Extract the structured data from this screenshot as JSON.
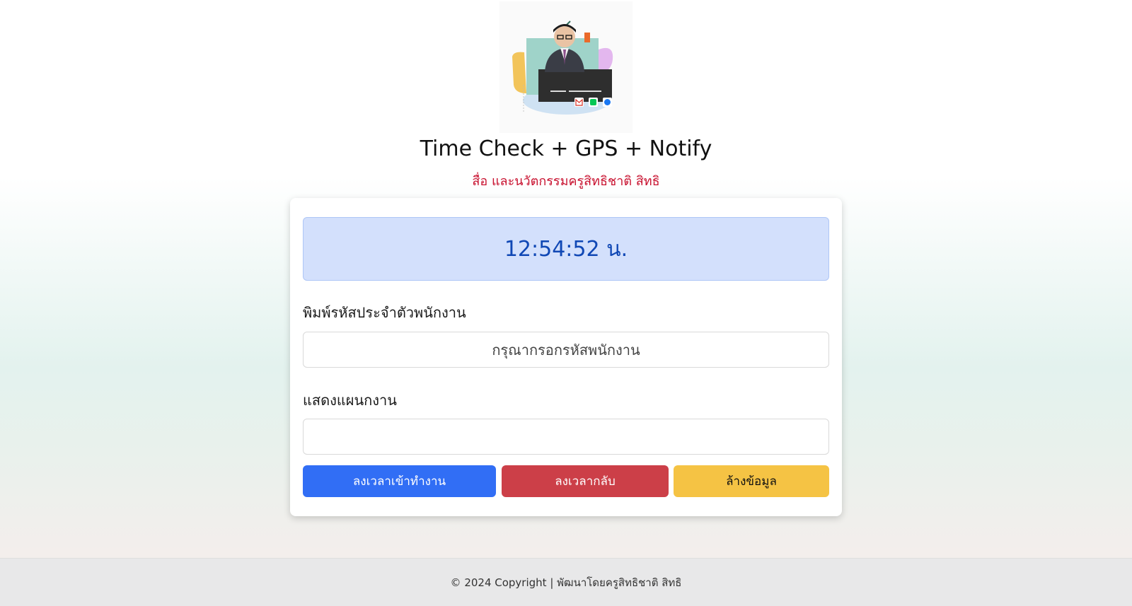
{
  "header": {
    "title": "Time Check + GPS + Notify",
    "subtitle": "สื่อ และนวัตกรรมครูสิทธิชาติ สิทธิ"
  },
  "clock": {
    "time": "12:54:52 น."
  },
  "form": {
    "employee_id_label": "พิมพ์รหัสประจำตัวพนักงาน",
    "employee_id_placeholder": "กรุณากรอกรหัสพนักงาน",
    "employee_id_value": "",
    "plan_label": "แสดงแผนกงาน",
    "plan_value": ""
  },
  "buttons": {
    "check_in": "ลงเวลาเข้าทำงาน",
    "check_out": "ลงเวลากลับ",
    "clear": "ล้างข้อมูล"
  },
  "footer": {
    "text": "© 2024 Copyright | พัฒนาโดยครูสิทธิชาติ สิทธิ"
  },
  "colors": {
    "primary": "#316ef5",
    "danger": "#cc3f48",
    "warning": "#f5c344",
    "subtitle": "#c8102e",
    "clock_text": "#1048b5"
  },
  "icons": [
    "gmail-icon",
    "line-icon",
    "facebook-icon"
  ]
}
